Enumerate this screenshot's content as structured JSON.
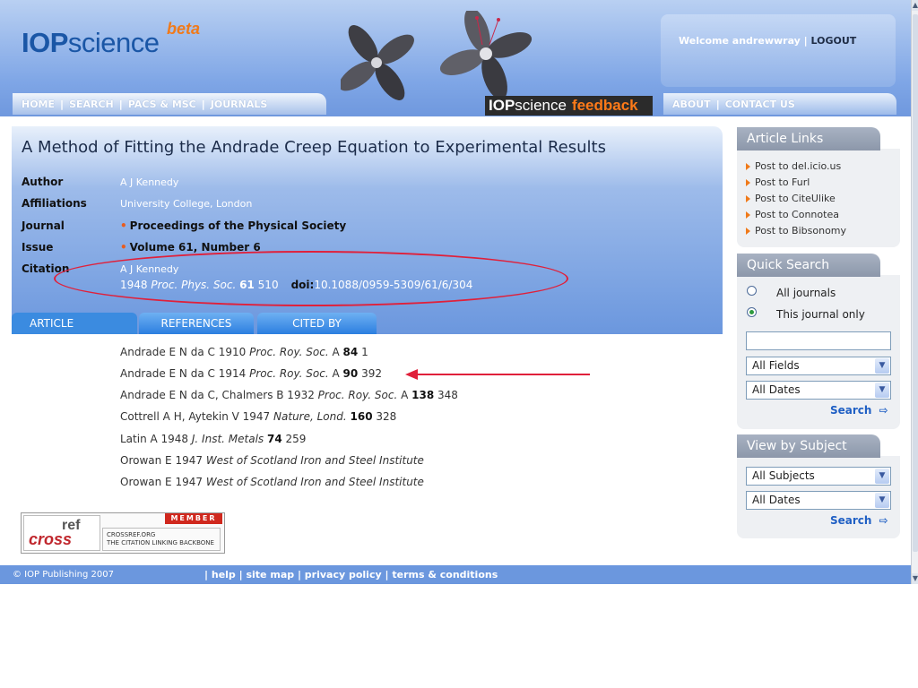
{
  "header": {
    "logo_iop": "IOP",
    "logo_science": "science",
    "beta": "beta",
    "welcome_text": "Welcome andrewwray | ",
    "logout": "LOGOUT",
    "nav_left": [
      "HOME",
      "SEARCH",
      "PACS & MSC",
      "JOURNALS"
    ],
    "nav_right": [
      "ABOUT",
      "CONTACT US"
    ],
    "feedback_iop": "IOP",
    "feedback_science": "science",
    "feedback_word": "feedback"
  },
  "article": {
    "title": "A Method of Fitting the Andrade Creep Equation to Experimental Results",
    "labels": {
      "author": "Author",
      "affiliations": "Affiliations",
      "journal": "Journal",
      "issue": "Issue",
      "citation": "Citation"
    },
    "author": "A J Kennedy",
    "affiliations": "University College, London",
    "journal": "Proceedings of the Physical Society",
    "issue": "Volume 61, Number 6",
    "citation_author": "A J Kennedy",
    "citation_year": "1948",
    "citation_journal": "Proc. Phys. Soc.",
    "citation_volume": "61",
    "citation_page": "510",
    "doi_label": "doi:",
    "doi": "10.1088/0959-5309/61/6/304"
  },
  "tabs": [
    "ARTICLE",
    "REFERENCES",
    "CITED BY"
  ],
  "references": [
    {
      "authors": "Andrade E N da C 1910",
      "journal": "Proc. Roy. Soc.",
      "series": "A",
      "volume": "84",
      "page": "1"
    },
    {
      "authors": "Andrade E N da C 1914",
      "journal": "Proc. Roy. Soc.",
      "series": "A",
      "volume": "90",
      "page": "392"
    },
    {
      "authors": "Andrade E N da C, Chalmers B 1932",
      "journal": "Proc. Roy. Soc.",
      "series": "A",
      "volume": "138",
      "page": "348"
    },
    {
      "authors": "Cottrell A H, Aytekin V 1947",
      "journal": "Nature, Lond.",
      "series": "",
      "volume": "160",
      "page": "328"
    },
    {
      "authors": "Latin A 1948",
      "journal": "J. Inst. Metals",
      "series": "",
      "volume": "74",
      "page": "259"
    },
    {
      "authors": "Orowan E 1947",
      "journal": "West of Scotland Iron and Steel Institute",
      "series": "",
      "volume": "",
      "page": ""
    },
    {
      "authors": "Orowan E 1947",
      "journal": "West of Scotland Iron and Steel Institute",
      "series": "",
      "volume": "",
      "page": ""
    }
  ],
  "crossref": {
    "member": "MEMBER",
    "logo_ref": "ref",
    "logo_cross": "cross",
    "line1": "CROSSREF.ORG",
    "line2": "THE CITATION LINKING BACKBONE"
  },
  "sidebar": {
    "article_links_title": "Article Links",
    "article_links": [
      "Post to del.icio.us",
      "Post to Furl",
      "Post to CiteUlike",
      "Post to Connotea",
      "Post to Bibsonomy"
    ],
    "quick_search_title": "Quick Search",
    "radio_all": "All journals",
    "radio_this": "This journal only",
    "search_value": "",
    "fields_select": "All Fields",
    "dates_select": "All Dates",
    "search_label": "Search",
    "view_subject_title": "View by Subject",
    "subjects_select": "All Subjects",
    "subject_dates_select": "All Dates",
    "search_label2": "Search"
  },
  "footer": {
    "copyright": "© IOP Publishing 2007",
    "links": [
      "help",
      "site map",
      "privacy policy",
      "terms & conditions"
    ]
  },
  "colors": {
    "header_blue": "#7fa6e6",
    "accent_orange": "#f07a1a",
    "annotation_red": "#e0203a",
    "tab_blue": "#3b8be0",
    "footer_blue": "#6b97de"
  }
}
